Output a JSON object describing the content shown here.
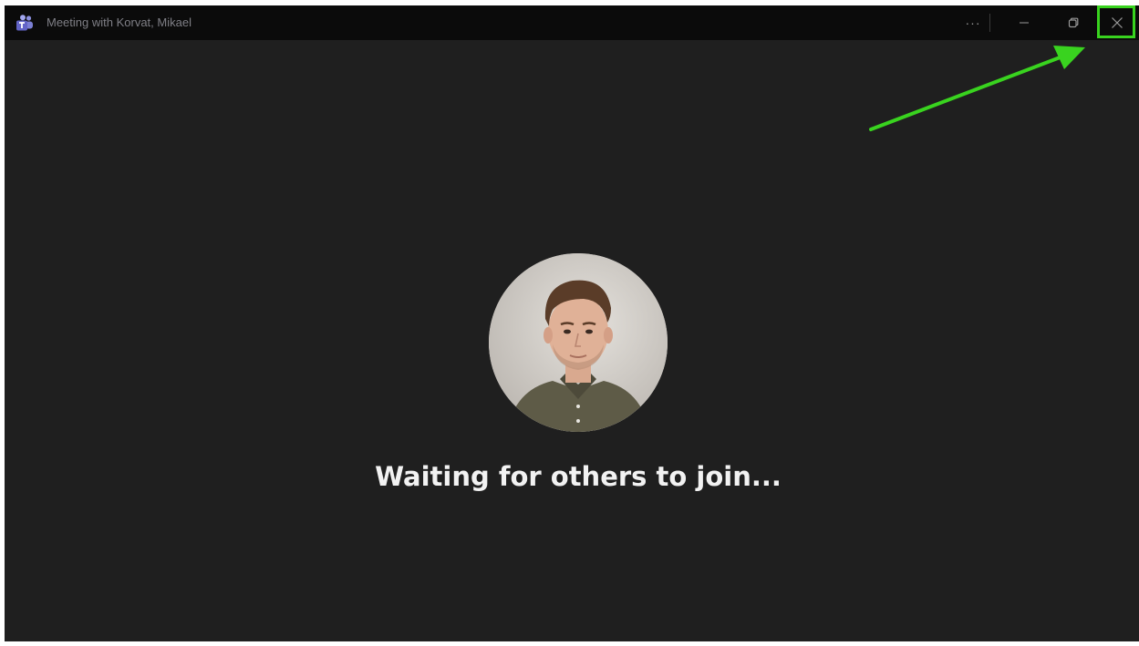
{
  "window": {
    "title": "Meeting with Korvat, Mikael"
  },
  "titlebar": {
    "more_label": "···",
    "icons": {
      "app": "teams-icon",
      "minimize": "minimize-icon",
      "restore": "restore-icon",
      "close": "close-icon"
    }
  },
  "main": {
    "status_text": "Waiting for others to join..."
  },
  "annotation": {
    "color": "#39d31f"
  }
}
